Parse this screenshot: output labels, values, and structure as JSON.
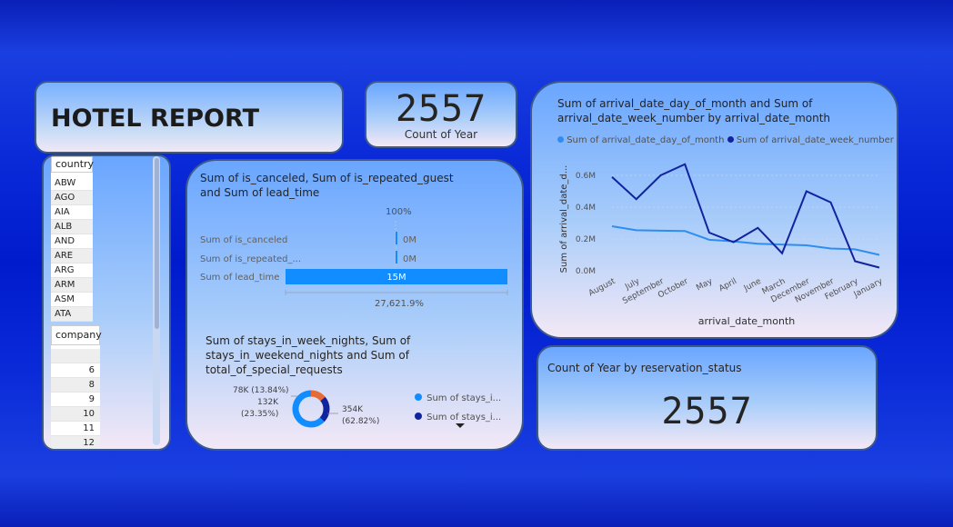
{
  "title": "HOTEL REPORT",
  "year_card": {
    "value": "2557",
    "label": "Count of Year"
  },
  "slicer": {
    "country_header": "country",
    "countries": [
      "ABW",
      "AGO",
      "AIA",
      "ALB",
      "AND",
      "ARE",
      "ARG",
      "ARM",
      "ASM",
      "ATA"
    ],
    "company_header": "company",
    "companies": [
      "",
      "6",
      "8",
      "9",
      "10",
      "11",
      "12"
    ]
  },
  "bar_card": {
    "title": "Sum of is_canceled, Sum of is_repeated_guest and Sum of lead_time",
    "top_label": "100%",
    "bottom_label": "27,621.9%"
  },
  "donut_card": {
    "title": "Sum of stays_in_week_nights, Sum of stays_in_weekend_nights and Sum of total_of_special_requests",
    "label_left_top": "78K (13.84%)",
    "label_left_mid": "132K",
    "label_left_bottom": "(23.35%)",
    "label_right_top": "354K",
    "label_right_bottom": "(62.82%)",
    "legend": [
      "Sum of stays_i...",
      "Sum of stays_i..."
    ]
  },
  "status_card": {
    "title": "Count of Year by reservation_status",
    "value": "2557"
  },
  "line_card": {
    "title": "Sum of arrival_date_day_of_month and Sum of arrival_date_week_number by arrival_date_month",
    "legend": [
      "Sum of arrival_date_day_of_month",
      "Sum of arrival_date_week_number"
    ],
    "ylabel": "Sum of arrival_date_d...",
    "xlabel": "arrival_date_month"
  },
  "colors": {
    "light_blue": "#118dff",
    "dark_blue": "#12239e",
    "orange": "#e66c37",
    "line_light": "#2e8ef0"
  },
  "chart_data": [
    {
      "type": "bar",
      "categories": [
        "Sum of is_canceled",
        "Sum of is_repeated_...",
        "Sum of lead_time"
      ],
      "values": [
        0,
        0,
        15000000
      ],
      "value_labels": [
        "0M",
        "0M",
        "15M"
      ],
      "ylim": [
        0,
        15000000
      ]
    },
    {
      "type": "pie",
      "categories": [
        "stays_in_weekend_nights",
        "total_of_special_requests",
        "stays_in_week_nights"
      ],
      "values": [
        78000,
        132000,
        354000
      ],
      "percents": [
        13.84,
        23.35,
        62.82
      ],
      "colors": [
        "#e66c37",
        "#12239e",
        "#118dff"
      ]
    },
    {
      "type": "line",
      "categories": [
        "August",
        "July",
        "September",
        "October",
        "May",
        "April",
        "June",
        "March",
        "December",
        "November",
        "February",
        "January"
      ],
      "series": [
        {
          "name": "Sum of arrival_date_day_of_month",
          "values": [
            0.28,
            0.255,
            0.252,
            0.25,
            0.195,
            0.185,
            0.17,
            0.165,
            0.16,
            0.14,
            0.135,
            0.1
          ]
        },
        {
          "name": "Sum of arrival_date_week_number",
          "values": [
            0.59,
            0.45,
            0.6,
            0.67,
            0.24,
            0.18,
            0.27,
            0.11,
            0.5,
            0.43,
            0.06,
            0.02
          ]
        }
      ],
      "yticks": [
        "0.0M",
        "0.2M",
        "0.4M",
        "0.6M"
      ],
      "ylim": [
        0,
        0.8
      ],
      "xlabel": "arrival_date_month",
      "ylabel": "Sum of arrival_date_d..."
    }
  ]
}
